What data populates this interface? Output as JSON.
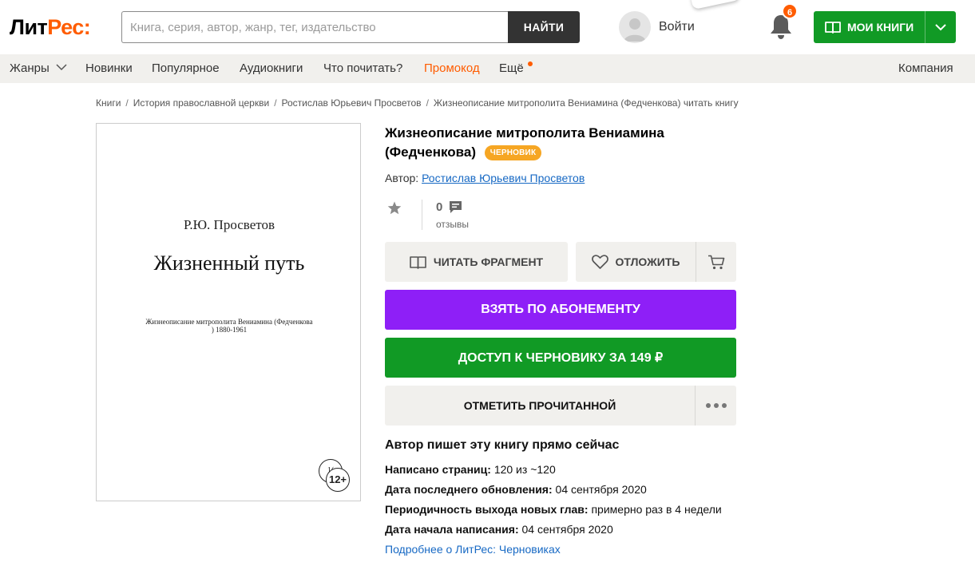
{
  "header": {
    "logo_part1": "Лит",
    "logo_part2": "Рес:",
    "search_placeholder": "Книга, серия, автор, жанр, тег, издательство",
    "search_button": "НАЙТИ",
    "login_label": "Войти",
    "notifications_count": "6",
    "my_books_label": "МОИ КНИГИ"
  },
  "nav": {
    "genres": "Жанры",
    "new": "Новинки",
    "popular": "Популярное",
    "audiobooks": "Аудиокниги",
    "what_to_read": "Что почитать?",
    "promo": "Промокод",
    "more": "Ещё",
    "company": "Компания"
  },
  "breadcrumb": [
    "Книги",
    "История православной церкви",
    "Ростислав Юрьевич Просветов",
    "Жизнеописание митрополита Вениамина (Федченкова) читать книгу"
  ],
  "cover": {
    "author": "Р.Ю. Просветов",
    "title": "Жизненный путь",
    "subtitle": "Жизнеописание митрополита Вениамина (Федченкова ) 1880-1961",
    "age_badge": "12+",
    "age_badge_back": "1("
  },
  "book": {
    "title": "Жизнеописание митрополита Вениамина (Федченкова)",
    "draft_badge": "ЧЕРНОВИК",
    "author_prefix": "Автор:",
    "author_name": "Ростислав Юрьевич Просветов",
    "reviews_count": "0",
    "reviews_label": "отзывы"
  },
  "actions": {
    "read_fragment": "ЧИТАТЬ ФРАГМЕНТ",
    "defer": "ОТЛОЖИТЬ",
    "subscribe": "ВЗЯТЬ ПО АБОНЕМЕНТУ",
    "draft_access": "ДОСТУП К ЧЕРНОВИКУ ЗА 149 ₽",
    "mark_read": "ОТМЕТИТЬ ПРОЧИТАННОЙ"
  },
  "draft_info": {
    "heading": "Автор пишет эту книгу прямо сейчас",
    "pages_label": "Написано страниц:",
    "pages_value": "120 из ~120",
    "last_update_label": "Дата последнего обновления:",
    "last_update_value": "04 сентября 2020",
    "frequency_label": "Периодичность выхода новых глав:",
    "frequency_value": "примерно раз в 4 недели",
    "start_label": "Дата начала написания:",
    "start_value": "04 сентября 2020",
    "more_link": "Подробнее о ЛитРес: Черновиках"
  },
  "colors": {
    "brand_orange": "#ff5c00",
    "green": "#119a25",
    "purple": "#8e1ff7",
    "draft_badge": "#f6a623",
    "link": "#1769c4"
  }
}
